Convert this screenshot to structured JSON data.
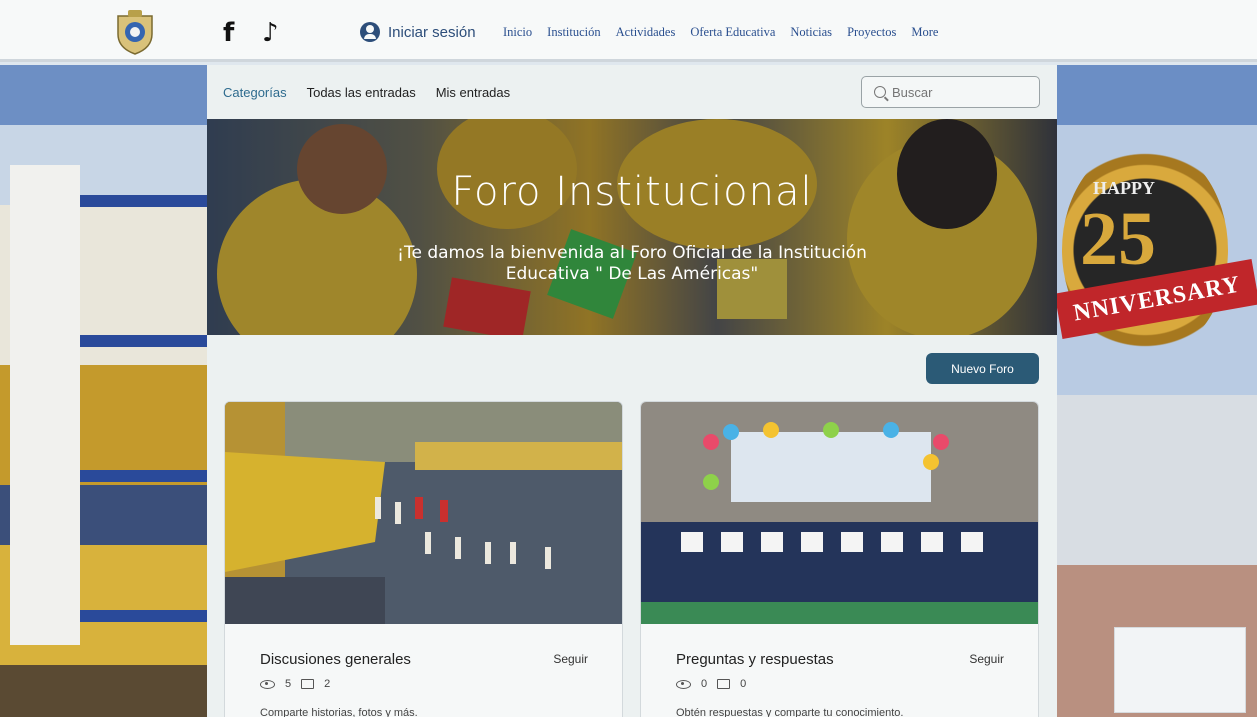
{
  "header": {
    "social": {
      "facebook": "f",
      "tiktok": "♪"
    },
    "login_label": "Iniciar sesión",
    "nav": [
      "Inicio",
      "Institución",
      "Actividades",
      "Oferta Educativa",
      "Noticias",
      "Proyectos",
      "More"
    ]
  },
  "background": {
    "badge_happy": "HAPPY",
    "badge_number": "25",
    "badge_ribbon": "NNIVERSARY"
  },
  "forum": {
    "tabs": [
      "Categorías",
      "Todas las entradas",
      "Mis entradas"
    ],
    "search_placeholder": "Buscar",
    "hero_title": "Foro Institucional",
    "hero_subtitle": "¡Te damos la bienvenida al Foro Oficial de la Institución Educativa \" De Las Américas\"",
    "new_forum_label": "Nuevo Foro",
    "cards": [
      {
        "title": "Discusiones generales",
        "follow": "Seguir",
        "views": "5",
        "comments": "2",
        "description": "Comparte historias, fotos y más."
      },
      {
        "title": "Preguntas y respuestas",
        "follow": "Seguir",
        "views": "0",
        "comments": "0",
        "description": "Obtén respuestas y comparte tu conocimiento."
      }
    ]
  },
  "colors": {
    "accent": "#2b5a76",
    "nav_link": "#2a4f8f"
  }
}
